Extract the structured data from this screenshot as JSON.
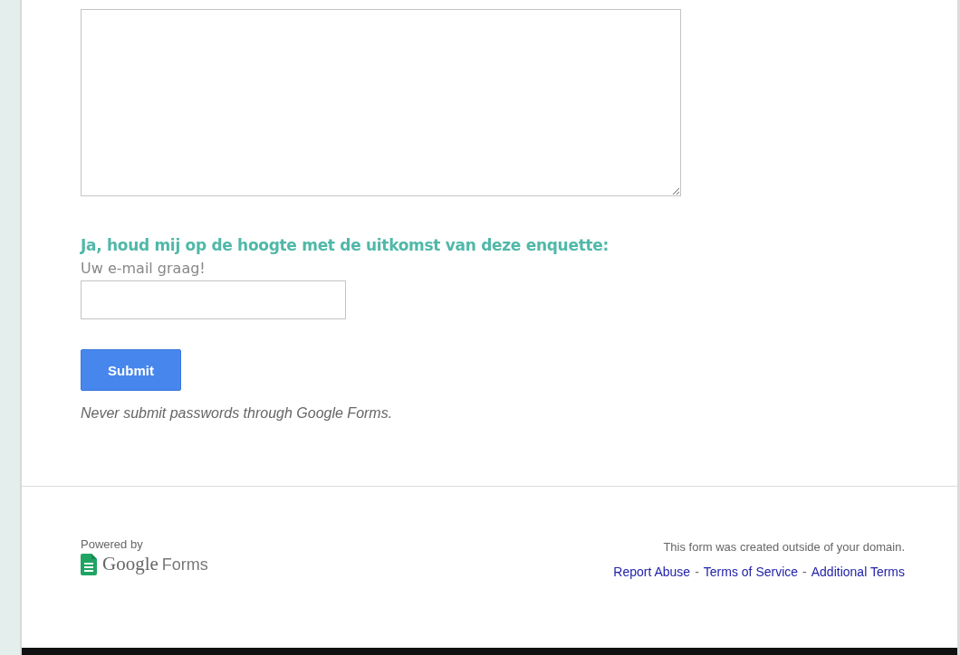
{
  "email_question": {
    "title": "Ja, houd mij op de hoogte met de uitkomst van deze enquette:",
    "help": "Uw e-mail graag!"
  },
  "submit": {
    "label": "Submit"
  },
  "warning": "Never submit passwords through Google Forms.",
  "footer": {
    "powered_by": "Powered by",
    "logo": {
      "brand": "Google",
      "product": "Forms"
    },
    "notice": "This form was created outside of your domain.",
    "links": [
      "Report Abuse",
      "Terms of Service",
      "Additional Terms"
    ],
    "separator": "-"
  }
}
